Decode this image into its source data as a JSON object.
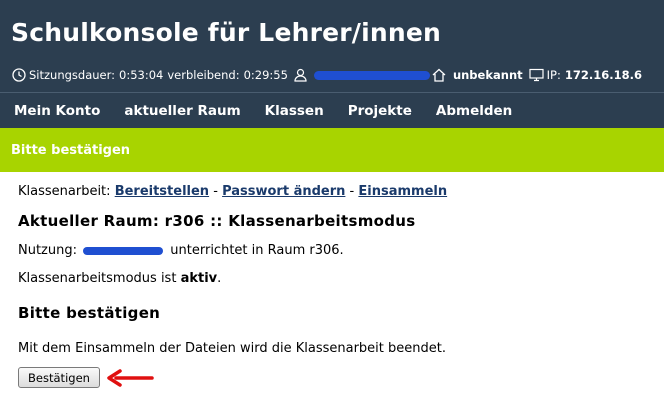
{
  "header": {
    "title": "Schulkonsole für Lehrer/innen",
    "session_label": "Sitzungsdauer:",
    "session_value": "0:53:04",
    "remaining_label": "verbleibend:",
    "remaining_value": "0:29:55",
    "room_value": "unbekannt",
    "ip_label": "IP:",
    "ip_value": "172.16.18.6"
  },
  "nav": {
    "items": [
      "Mein Konto",
      "aktueller Raum",
      "Klassen",
      "Projekte",
      "Abmelden"
    ]
  },
  "banner": {
    "text": "Bitte bestätigen"
  },
  "main": {
    "exam_label": "Klassenarbeit:",
    "links": [
      "Bereitstellen",
      "Passwort ändern",
      "Einsammeln"
    ],
    "separator": "-",
    "heading": "Aktueller Raum: r306 :: Klassenarbeitsmodus",
    "usage_label": "Nutzung:",
    "usage_rest": "unterrichtet in Raum r306.",
    "mode_text": "Klassenarbeitsmodus ist",
    "mode_status": "aktiv",
    "mode_end": ".",
    "confirm_heading": "Bitte bestätigen",
    "confirm_message": "Mit dem Einsammeln der Dateien wird die Klassenarbeit beendet.",
    "confirm_button": "Bestätigen"
  },
  "colors": {
    "header_bg": "#2c3e50",
    "banner_bg": "#a8d400",
    "link": "#1a3a6b",
    "redaction": "#1f4fd1",
    "arrow": "#e01010"
  }
}
